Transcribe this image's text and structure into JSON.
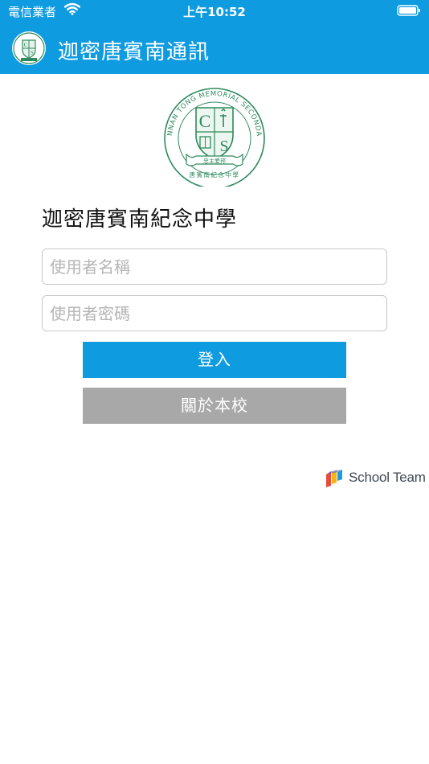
{
  "status_bar": {
    "carrier": "電信業者",
    "time": "上午10:52",
    "wifi_icon": "wifi-icon",
    "battery_icon": "battery-icon"
  },
  "nav_bar": {
    "title": "迦密唐賓南通訊",
    "logo_icon": "school-crest-icon"
  },
  "crest": {
    "icon": "school-crest-icon",
    "outer_text": "CARMEL BUNNAN TONG MEMORIAL SECONDARY SCHOOL",
    "inner_text": "唐賓南紀念中學",
    "motto": "忠主爱邦",
    "color": "#2e8a5e"
  },
  "school_name": "迦密唐賓南紀念中學",
  "login_form": {
    "username_placeholder": "使用者名稱",
    "password_placeholder": "使用者密碼",
    "login_label": "登入",
    "about_label": "關於本校"
  },
  "brand": {
    "name": "School Team",
    "icon": "school-team-logo-icon"
  },
  "colors": {
    "primary": "#0f9be0",
    "secondary_button": "#a8a8a8",
    "crest_green": "#2e8a5e"
  }
}
